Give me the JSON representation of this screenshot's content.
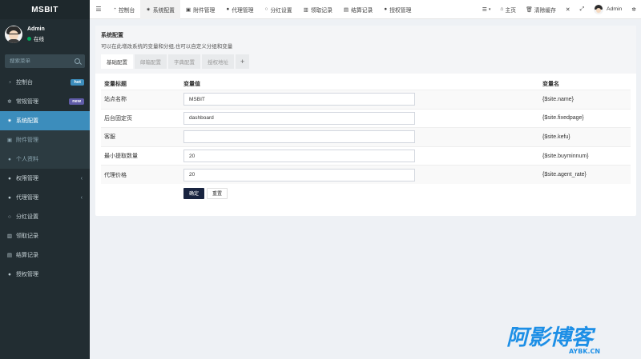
{
  "sidebar": {
    "brand": "MSBIT",
    "user": {
      "name": "Admin",
      "status": "在线"
    },
    "search_placeholder": "搜索菜单",
    "items": [
      {
        "label": "控制台",
        "icon": "dashboard-icon",
        "badge": "hot"
      },
      {
        "label": "常规管理",
        "icon": "cogs-icon",
        "badge": "new"
      },
      {
        "label": "系统配置",
        "icon": "cog-icon"
      },
      {
        "label": "附件管理",
        "icon": "file-image-icon"
      },
      {
        "label": "个人资料",
        "icon": "user-icon"
      },
      {
        "label": "权限管理",
        "icon": "group-icon"
      },
      {
        "label": "代理管理",
        "icon": "users-icon"
      },
      {
        "label": "分红设置",
        "icon": "circle-o-icon"
      },
      {
        "label": "领取记录",
        "icon": "barcode-icon"
      },
      {
        "label": "结算记录",
        "icon": "list-alt-icon"
      },
      {
        "label": "授权管理",
        "icon": "group-icon"
      }
    ]
  },
  "topbar": {
    "tabs": [
      {
        "label": "控制台",
        "icon": "dashboard-icon"
      },
      {
        "label": "系统配置",
        "icon": "cog-icon"
      },
      {
        "label": "附件管理",
        "icon": "file-image-icon"
      },
      {
        "label": "代理管理",
        "icon": "user-icon"
      },
      {
        "label": "分红设置",
        "icon": "circle-o-icon"
      },
      {
        "label": "领取记录",
        "icon": "barcode-icon"
      },
      {
        "label": "结算记录",
        "icon": "list-alt-icon"
      },
      {
        "label": "授权管理",
        "icon": "group-icon"
      }
    ],
    "home_label": "主页",
    "clear_cache_label": "清除缓存",
    "user_name": "Admin"
  },
  "panel": {
    "title": "系统配置",
    "description": "可以在此增改系统的变量和分组,也可以自定义分组和变量",
    "tabs": [
      "基础配置",
      "邮箱配置",
      "字典配置",
      "授权地址"
    ],
    "add_tab_label": "+",
    "columns": [
      "变量标题",
      "变量值",
      "变量名"
    ],
    "rows": [
      {
        "title": "站点名称",
        "value": "MSBIT",
        "name": "{$site.name}"
      },
      {
        "title": "后台固定页",
        "value": "dashboard",
        "name": "{$site.fixedpage}"
      },
      {
        "title": "客服",
        "value": "",
        "name": "{$site.kefu}"
      },
      {
        "title": "最小提取数量",
        "value": "20",
        "name": "{$site.buyminnum}"
      },
      {
        "title": "代理价格",
        "value": "20",
        "name": "{$site.agent_rate}"
      }
    ],
    "confirm_label": "确定",
    "reset_label": "重置"
  },
  "watermark": {
    "main": "阿影博客",
    "sub": "AYBK.CN"
  }
}
